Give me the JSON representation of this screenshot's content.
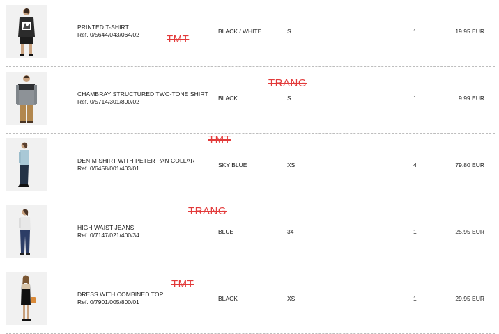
{
  "items": [
    {
      "name": "PRINTED T-SHIRT",
      "ref": "Ref. 0/5644/043/064/02",
      "color": "BLACK / WHITE",
      "size": "S",
      "qty": "1",
      "price": "19.95 EUR",
      "annotation": "TMT"
    },
    {
      "name": "CHAMBRAY STRUCTURED TWO-TONE SHIRT",
      "ref": "Ref. 0/5714/301/800/02",
      "color": "BLACK",
      "size": "S",
      "qty": "1",
      "price": "9.99 EUR",
      "annotation": "TRANG"
    },
    {
      "name": "DENIM SHIRT WITH PETER PAN COLLAR",
      "ref": "Ref. 0/6458/001/403/01",
      "color": "SKY BLUE",
      "size": "XS",
      "qty": "4",
      "price": "79.80 EUR",
      "annotation": "TMT"
    },
    {
      "name": "HIGH WAIST JEANS",
      "ref": "Ref. 0/7147/021/400/34",
      "color": "BLUE",
      "size": "34",
      "qty": "1",
      "price": "25.95 EUR",
      "annotation": "TRANG"
    },
    {
      "name": "DRESS WITH COMBINED TOP",
      "ref": "Ref. 0/7901/005/800/01",
      "color": "BLACK",
      "size": "XS",
      "qty": "1",
      "price": "29.95 EUR",
      "annotation": "TMT"
    }
  ],
  "colors": {
    "annotation": "#e23a3a",
    "divider": "#bdbdbd",
    "text": "#1a1a1a"
  }
}
